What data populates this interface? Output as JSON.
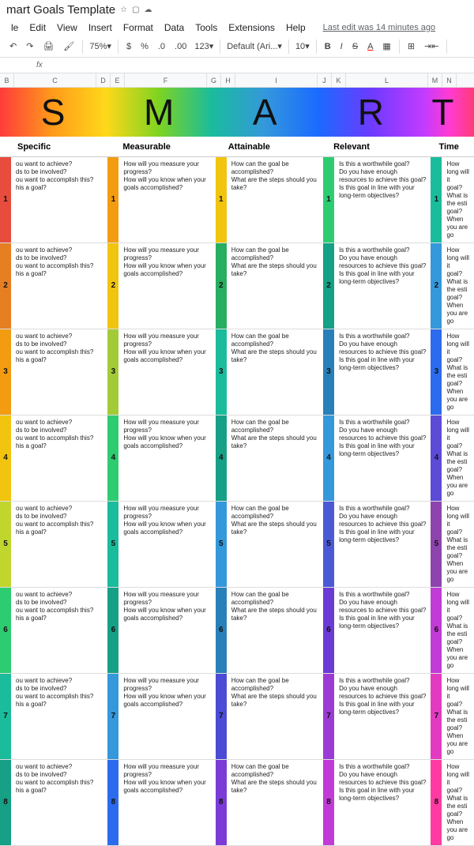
{
  "doc": {
    "title": "mart Goals Template",
    "last_edit": "Last edit was 14 minutes ago"
  },
  "menu": {
    "file": "le",
    "edit": "Edit",
    "view": "View",
    "insert": "Insert",
    "format": "Format",
    "data": "Data",
    "tools": "Tools",
    "extensions": "Extensions",
    "help": "Help"
  },
  "toolbar": {
    "zoom": "75%",
    "currency": "$",
    "percent": "%",
    "dec_dec": ".0",
    "dec_inc": ".00",
    "numfmt": "123",
    "font": "Default (Ari...",
    "fontsize": "10"
  },
  "fx": {
    "label": "fx"
  },
  "cols": [
    "B",
    "C",
    "D",
    "E",
    "F",
    "G",
    "H",
    "I",
    "J",
    "K",
    "L",
    "M",
    "N"
  ],
  "smart": {
    "s": "S",
    "m": "M",
    "a": "A",
    "r": "R",
    "t": "T"
  },
  "headers": {
    "specific": "Specific",
    "measurable": "Measurable",
    "attainable": "Attainable",
    "relevant": "Relevant",
    "time": "Time"
  },
  "questions": {
    "specific": "ou want to achieve?\nds to be involved?\nou want to accomplish this?\nhis a goal?",
    "measurable": "How will you measure your progress?\nHow will you know when your goals accomplished?",
    "attainable": "How can the goal be accomplished?\nWhat are the steps should you take?",
    "relevant": "Is this a worthwhile goal?\nDo you have enough resources to achieve this goal?\nIs this goal in line with your long-term objectives?",
    "time": "How long will it\ngoal?\nWhat is the esti\ngoal?\nWhen you are go"
  },
  "row_colors": [
    {
      "s": "#e74c3c",
      "m": "#f39c12",
      "a": "#f1c40f",
      "r": "#2ecc71",
      "t": "#1abc9c"
    },
    {
      "s": "#e67e22",
      "m": "#f1c40f",
      "a": "#27ae60",
      "r": "#16a085",
      "t": "#3498db"
    },
    {
      "s": "#f39c12",
      "m": "#a3cb38",
      "a": "#1abc9c",
      "r": "#2980b9",
      "t": "#2c6bed"
    },
    {
      "s": "#f1c40f",
      "m": "#2ecc71",
      "a": "#16a085",
      "r": "#3498db",
      "t": "#5b4bd6"
    },
    {
      "s": "#c0d62e",
      "m": "#1abc9c",
      "a": "#3498db",
      "r": "#4b59d6",
      "t": "#8e44ad"
    },
    {
      "s": "#2ecc71",
      "m": "#16a085",
      "a": "#2980b9",
      "r": "#6b3bd6",
      "t": "#c13bd6"
    },
    {
      "s": "#1abc9c",
      "m": "#3498db",
      "a": "#4b4bd6",
      "r": "#9b3bd6",
      "t": "#e23bc1"
    },
    {
      "s": "#16a085",
      "m": "#2c6bed",
      "a": "#7b3bd6",
      "r": "#c13bd6",
      "t": "#ff3ba3"
    }
  ]
}
